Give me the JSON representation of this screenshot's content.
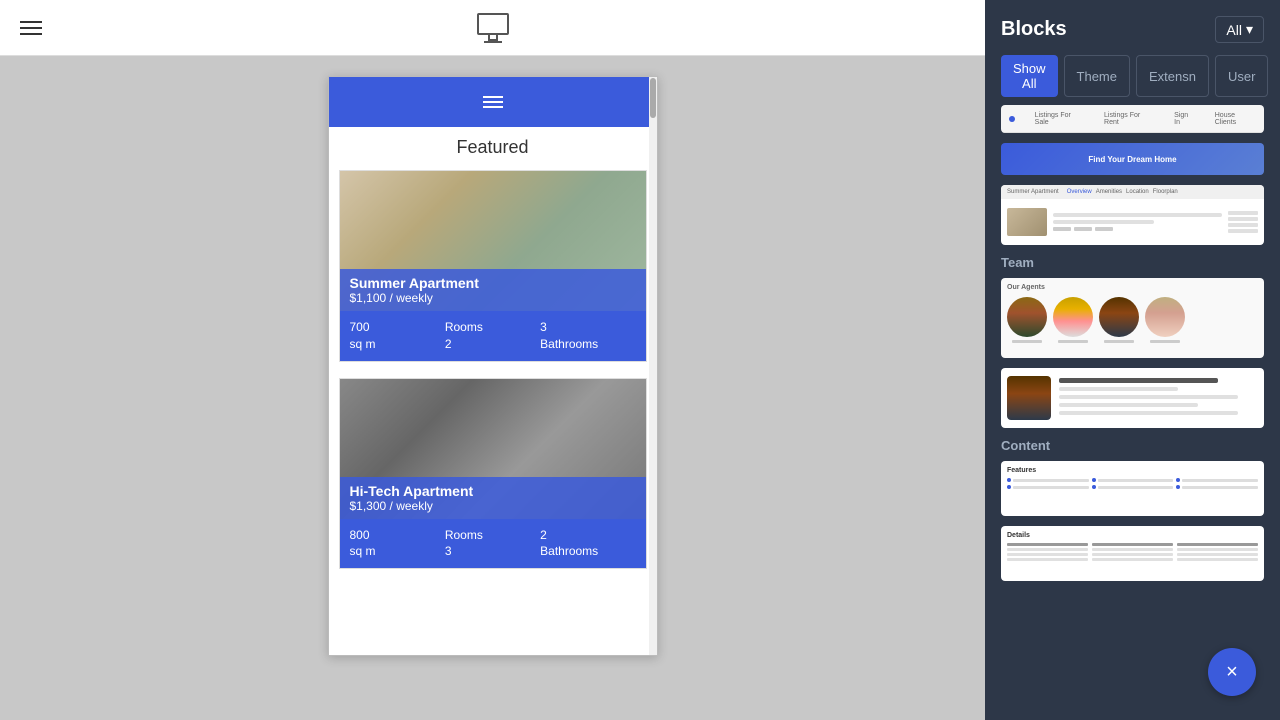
{
  "topbar": {
    "monitor_label": "Monitor view"
  },
  "panel": {
    "title": "Blocks",
    "all_label": "All",
    "tabs": [
      {
        "id": "show-all",
        "label": "Show All",
        "active": true
      },
      {
        "id": "theme",
        "label": "Theme",
        "active": false
      },
      {
        "id": "extension",
        "label": "Extensn",
        "active": false
      },
      {
        "id": "user",
        "label": "User",
        "active": false
      }
    ],
    "sections": [
      {
        "id": "listing",
        "label": "",
        "blocks": [
          {
            "id": "nav-block",
            "type": "nav"
          },
          {
            "id": "hero-block",
            "type": "hero",
            "text": "Find Your Dream Home"
          },
          {
            "id": "listing-block",
            "type": "listing"
          }
        ]
      },
      {
        "id": "team",
        "label": "Team",
        "blocks": [
          {
            "id": "team-grid-block",
            "type": "team-grid"
          },
          {
            "id": "agent-block",
            "type": "agent"
          }
        ]
      },
      {
        "id": "content",
        "label": "Content",
        "blocks": [
          {
            "id": "features-block",
            "type": "features"
          },
          {
            "id": "details-block",
            "type": "details"
          }
        ]
      }
    ]
  },
  "preview": {
    "title": "Featured",
    "properties": [
      {
        "id": "prop1",
        "name": "Summer Apartment",
        "price": "$1,100 / weekly",
        "sqm": "700 sq m",
        "rooms": "Rooms\n2",
        "bathrooms": "3\nBathrooms",
        "rooms_label": "Rooms",
        "rooms_value": "2",
        "bathrooms_value": "3",
        "bathrooms_label": "Bathrooms",
        "sqm_label": "700",
        "sqm_unit": "sq m"
      },
      {
        "id": "prop2",
        "name": "Hi-Tech Apartment",
        "price": "$1,300 / weekly",
        "sqm": "800 sq m",
        "rooms": "Rooms\n3",
        "rooms_label": "Rooms",
        "rooms_value": "3",
        "bathrooms_value": "2",
        "bathrooms_label": "Bathrooms",
        "sqm_label": "800",
        "sqm_unit": "sq m"
      }
    ]
  },
  "close_button": "×"
}
